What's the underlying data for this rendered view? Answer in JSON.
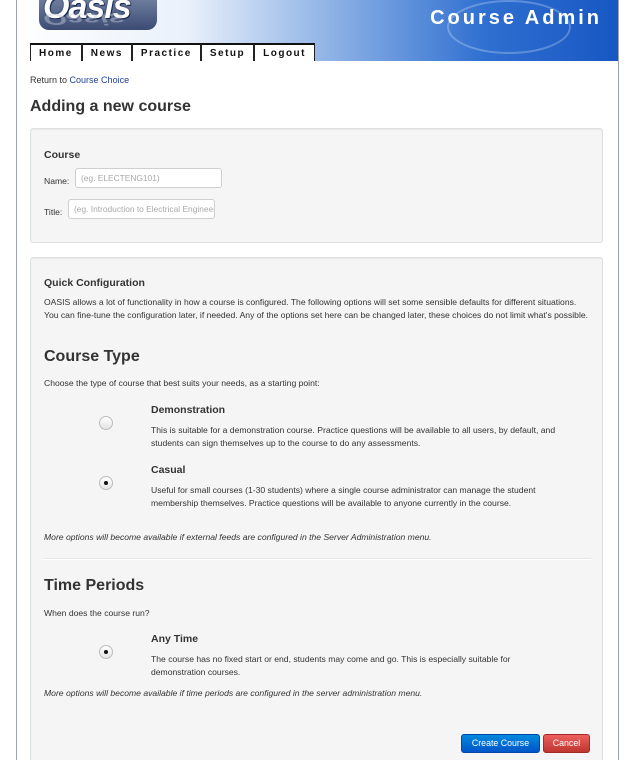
{
  "header": {
    "logo_text": "Oasis",
    "app_title": "Course Admin"
  },
  "nav": {
    "tabs": [
      {
        "label": "Home"
      },
      {
        "label": "News"
      },
      {
        "label": "Practice"
      },
      {
        "label": "Setup"
      },
      {
        "label": "Logout"
      }
    ]
  },
  "breadcrumb": {
    "prefix": "Return to",
    "link": "Course Choice"
  },
  "page_title": "Adding a new course",
  "course": {
    "heading": "Course",
    "name_label": "Name:",
    "name_placeholder": "(eg. ELECTENG101)",
    "title_label": "Title:",
    "title_placeholder": "(eg. Introduction to Electrical Engineering)"
  },
  "quick_config": {
    "heading": "Quick Configuration",
    "description": "OASIS allows a lot of functionality in how a course is configured. The following options will set some sensible defaults for different situations. You can fine-tune the configuration later, if needed. Any of the options set here can be changed later, these choices do not limit what's possible."
  },
  "course_type": {
    "heading": "Course Type",
    "prompt": "Choose the type of course that best suits your needs, as a starting point:",
    "options": [
      {
        "title": "Demonstration",
        "description": "This is suitable for a demonstration course. Practice questions will be available to all users, by default, and students can sign themselves up to the course to do any assessments.",
        "selected": false
      },
      {
        "title": "Casual",
        "description": "Useful for small courses (1-30 students) where a single course administrator can manage the student membership themselves. Practice questions will be available to anyone currently in the course.",
        "selected": true
      }
    ],
    "note": "More options will become available if external feeds are configured in the Server Administration menu."
  },
  "time_periods": {
    "heading": "Time Periods",
    "prompt": "When does the course run?",
    "options": [
      {
        "title": "Any Time",
        "description": "The course has no fixed start or end, students may come and go. This is especially suitable for demonstration courses.",
        "selected": true
      }
    ],
    "note": "More options will become available if time periods are configured in the server administration menu."
  },
  "actions": {
    "create_label": "Create Course",
    "cancel_label": "Cancel"
  },
  "colors": {
    "primary": "#0066cc",
    "danger": "#da4f49",
    "header_blue": "#1757c3"
  }
}
